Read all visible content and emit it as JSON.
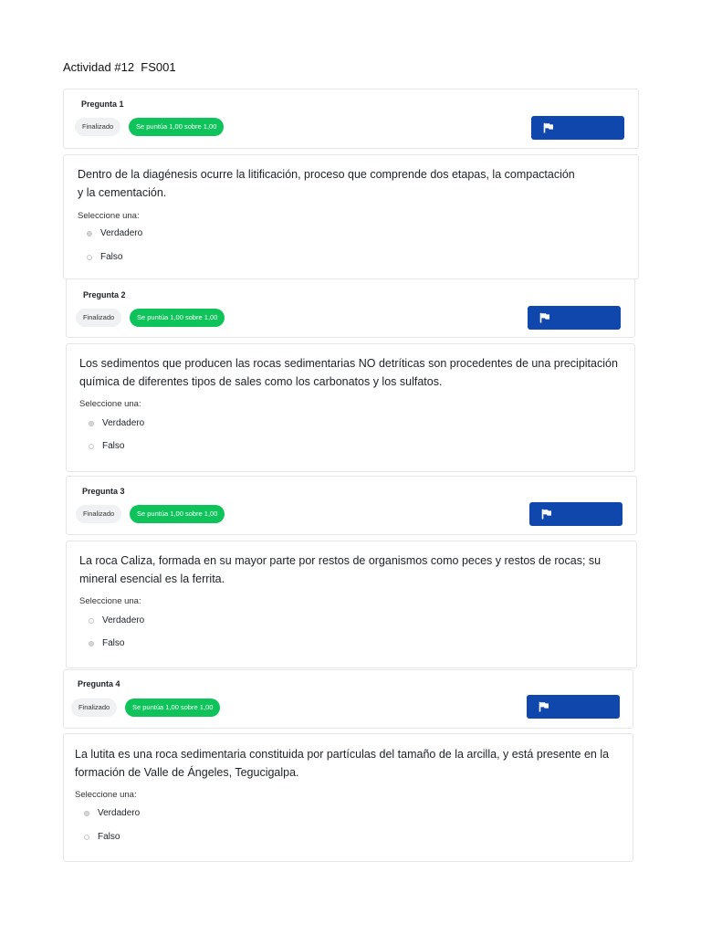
{
  "page": {
    "title": "Actividad #12  FS001"
  },
  "questions": [
    {
      "label": "Pregunta 1",
      "status": "Finalizado",
      "grade": "Se puntúa 1,00 sobre 1,00",
      "text": "Dentro de la diagénesis ocurre la litificación, proceso que comprende dos etapas, la compactación y la cementación.",
      "prompt": "Seleccione una:",
      "options": [
        {
          "label": "Verdadero",
          "selected": true
        },
        {
          "label": "Falso",
          "selected": false
        }
      ]
    },
    {
      "label": "Pregunta 2",
      "status": "Finalizado",
      "grade": "Se puntúa 1,00 sobre 1,00",
      "text": "Los sedimentos que producen las  rocas sedimentarias NO detríticas son procedentes de una precipitación química de diferentes tipos de sales como los carbonatos y los sulfatos.",
      "prompt": "Seleccione una:",
      "options": [
        {
          "label": "Verdadero",
          "selected": true
        },
        {
          "label": "Falso",
          "selected": false
        }
      ]
    },
    {
      "label": "Pregunta 3",
      "status": "Finalizado",
      "grade": "Se puntúa 1,00 sobre 1,00",
      "text": "La roca Caliza, formada en su mayor parte por restos de organismos como peces y restos de rocas; su mineral esencial es la ferrita.",
      "prompt": "Seleccione una:",
      "options": [
        {
          "label": "Verdadero",
          "selected": false
        },
        {
          "label": "Falso",
          "selected": true
        }
      ]
    },
    {
      "label": "Pregunta 4",
      "status": "Finalizado",
      "grade": "Se puntúa 1,00 sobre 1,00",
      "text": "La lutita es una roca sedimentaria constituida por partículas del tamaño de la arcilla, y está presente en la formación de Valle de Ángeles, Tegucigalpa.",
      "prompt": "Seleccione una:",
      "options": [
        {
          "label": "Verdadero",
          "selected": true
        },
        {
          "label": "Falso",
          "selected": false
        }
      ]
    }
  ],
  "colors": {
    "accent": "#0f47ad",
    "success": "#0fc35b",
    "border": "#e4e6e8"
  },
  "icons": {
    "flag_button": "flag-icon",
    "option": "radio-icon"
  }
}
